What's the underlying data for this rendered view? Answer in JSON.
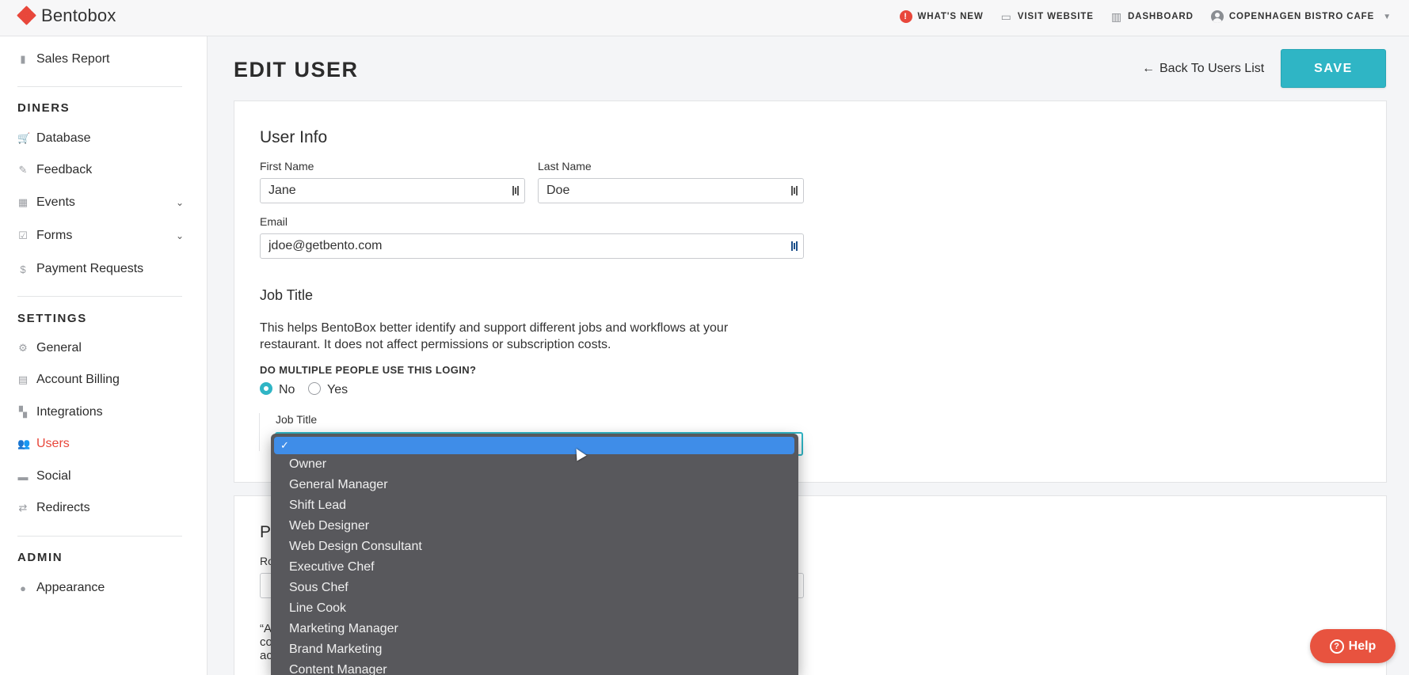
{
  "brand": {
    "name": "Bentobox",
    "accent": "#e8473b",
    "teal": "#2fb5c5"
  },
  "topnav": {
    "whats_new": "WHAT'S NEW",
    "visit_website": "VISIT WEBSITE",
    "dashboard": "DASHBOARD",
    "account": "COPENHAGEN BISTRO CAFE"
  },
  "sidebar": {
    "sales_report": "Sales Report",
    "diners_heading": "DINERS",
    "database": "Database",
    "feedback": "Feedback",
    "events": "Events",
    "forms": "Forms",
    "payment_requests": "Payment Requests",
    "settings_heading": "SETTINGS",
    "general": "General",
    "account_billing": "Account Billing",
    "integrations": "Integrations",
    "users": "Users",
    "social": "Social",
    "redirects": "Redirects",
    "admin_heading": "ADMIN",
    "appearance": "Appearance"
  },
  "header": {
    "title": "EDIT USER",
    "back_link": "Back To Users List",
    "save": "SAVE"
  },
  "user_info": {
    "title": "User Info",
    "first_name_label": "First Name",
    "first_name": "Jane",
    "last_name_label": "Last Name",
    "last_name": "Doe",
    "email_label": "Email",
    "email": "jdoe@getbento.com"
  },
  "job_title": {
    "title": "Job Title",
    "help": "This helps BentoBox better identify and support different jobs and workflows at your restaurant. It does not affect permissions or subscription costs.",
    "multi_question": "DO MULTIPLE PEOPLE USE THIS LOGIN?",
    "radio_no": "No",
    "radio_yes": "Yes",
    "select_label": "Job Title",
    "selected_mark": "✓",
    "options": [
      "Owner",
      "General Manager",
      "Shift Lead",
      "Web Designer",
      "Web Design Consultant",
      "Executive Chef",
      "Sous Chef",
      "Line Cook",
      "Marketing Manager",
      "Brand Marketing",
      "Content Manager"
    ]
  },
  "second_card": {
    "title_fragment": "P",
    "label_fragment": "Ro",
    "text_fragment_1": "“A",
    "text_fragment_2": "co",
    "text_fragment_3": "ac"
  },
  "help_button": {
    "label": "Help"
  }
}
